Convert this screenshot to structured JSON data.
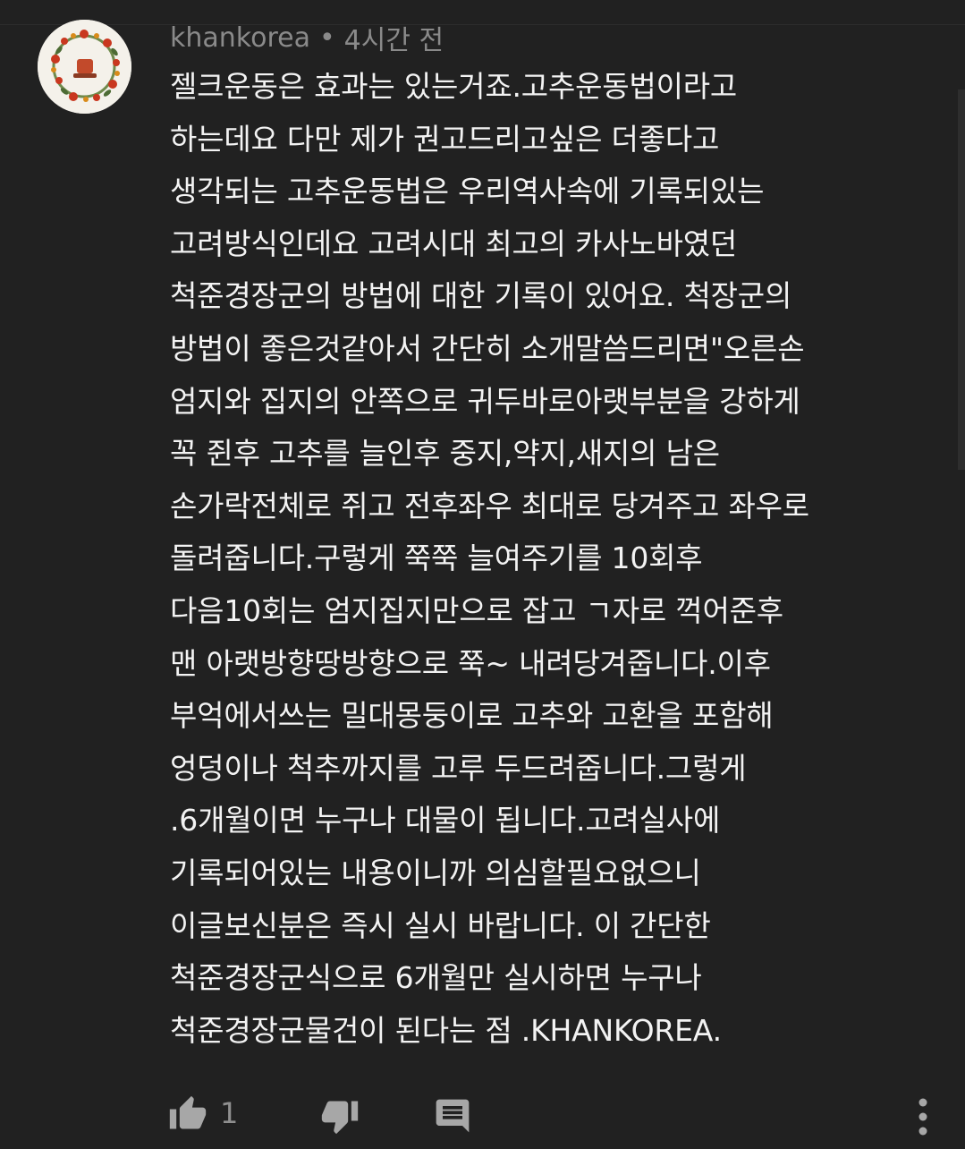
{
  "comment": {
    "author": "khankorea",
    "separator": "•",
    "time_ago": "4시간 전",
    "text": "젤크운동은 효과는 있는거죠.고추운동법이라고\n하는데요 다만 제가 권고드리고싶은 더좋다고\n생각되는 고추운동법은 우리역사속에 기록되있는\n고려방식인데요 고려시대 최고의 카사노바였던\n척준경장군의 방법에 대한 기록이 있어요. 척장군의\n방법이 좋은것같아서  간단히 소개말씀드리면\"오른손\n엄지와 집지의 안쪽으로 귀두바로아랫부분을 강하게\n꼭 쥔후 고추를 늘인후 중지,약지,새지의 남은\n손가락전체로 쥐고 전후좌우 최대로 당겨주고 좌우로\n돌려줍니다.구렇게  쭉쭉 늘여주기를 10회후\n다음10회는 엄지집지만으로 잡고 ㄱ자로 꺽어준후\n맨 아랫방향땅방향으로 쭉~ 내려당겨줍니다.이후\n부억에서쓰는 밀대몽둥이로 고추와 고환을 포함해\n엉덩이나 척추까지를 고루 두드려줍니다.그렇게\n.6개월이면 누구나 대물이 됩니다.고려실사에\n기록되어있는 내용이니까 의심할필요없으니\n이글보신분은 즉시 실시 바랍니다. 이 간단한\n척준경장군식으로 6개월만 실시하면 누구나\n척준경장군물건이 된다는 점 .KHANKOREA.",
    "like_count": "1"
  },
  "icons": {
    "like": "thumb-up-icon",
    "dislike": "thumb-down-icon",
    "reply": "comment-icon",
    "more": "more-vertical-icon"
  },
  "colors": {
    "background": "#212121",
    "text": "#f3f3f3",
    "meta": "#8a8a8a",
    "icon": "#a7a7a7"
  }
}
